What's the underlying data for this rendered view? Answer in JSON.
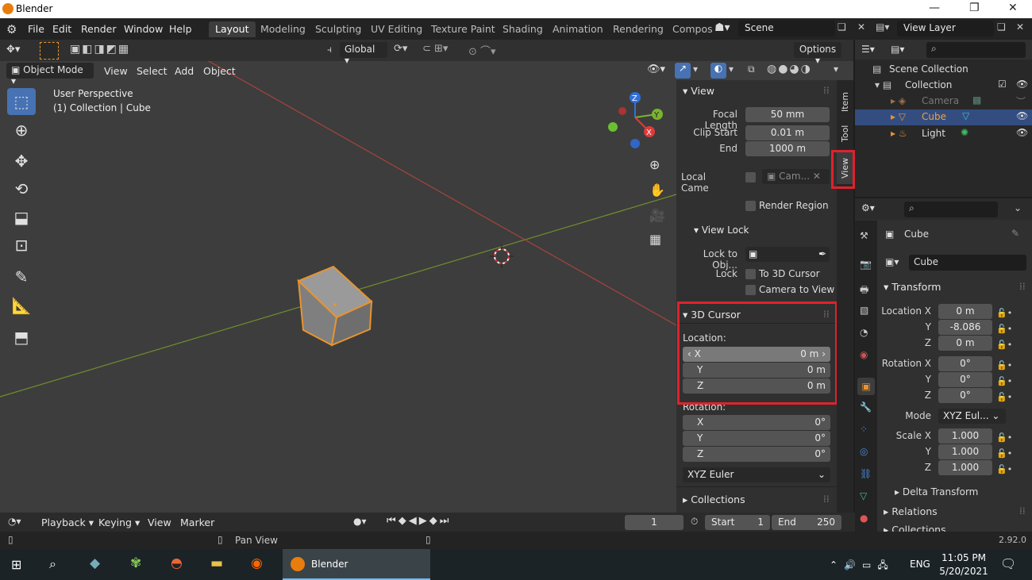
{
  "window": {
    "title": "Blender"
  },
  "menu": [
    "File",
    "Edit",
    "Render",
    "Window",
    "Help"
  ],
  "workspaces": [
    "Layout",
    "Modeling",
    "Sculpting",
    "UV Editing",
    "Texture Paint",
    "Shading",
    "Animation",
    "Rendering",
    "Compos"
  ],
  "scene": "Scene",
  "view_layer": "View Layer",
  "header": {
    "transform_orientation": "Global",
    "options": "Options"
  },
  "viewport_header": {
    "mode": "Object Mode",
    "view": "View",
    "select": "Select",
    "add": "Add",
    "object": "Object"
  },
  "viewport": {
    "perspective": "User Perspective",
    "collection_info": "(1) Collection | Cube"
  },
  "gizmo": {
    "x": "X",
    "y": "Y",
    "z": "Z"
  },
  "npanel": {
    "tabs": [
      "Item",
      "Tool",
      "View"
    ],
    "view_section": "View",
    "focal_length_label": "Focal Length",
    "focal_length": "50 mm",
    "clip_start_label": "Clip Start",
    "clip_start": "0.01 m",
    "end_label": "End",
    "end": "1000 m",
    "local_camera_label": "Local Came",
    "local_camera_value": "Cam...",
    "render_region": "Render Region",
    "view_lock": "View Lock",
    "lock_to_obj": "Lock to Obj...",
    "lock_label": "Lock",
    "to_3d_cursor": "To 3D Cursor",
    "camera_to_view": "Camera to View",
    "cursor_section": "3D Cursor",
    "location_label": "Location:",
    "loc_x_label": "X",
    "loc_x": "0 m",
    "loc_y_label": "Y",
    "loc_y": "0 m",
    "loc_z_label": "Z",
    "loc_z": "0 m",
    "rotation_label": "Rotation:",
    "rot_x_label": "X",
    "rot_x": "0°",
    "rot_y_label": "Y",
    "rot_y": "0°",
    "rot_z_label": "Z",
    "rot_z": "0°",
    "rotation_mode": "XYZ Euler",
    "collections": "Collections"
  },
  "outliner": {
    "scene_collection": "Scene Collection",
    "collection": "Collection",
    "items": [
      "Camera",
      "Cube",
      "Light"
    ]
  },
  "properties": {
    "object_name": "Cube",
    "data_name": "Cube",
    "transform": "Transform",
    "loc_x_label": "Location X",
    "loc_x": "0 m",
    "loc_y_label": "Y",
    "loc_y": "-8.086",
    "loc_z_label": "Z",
    "loc_z": "0 m",
    "rot_x_label": "Rotation X",
    "rot_x": "0°",
    "rot_y_label": "Y",
    "rot_y": "0°",
    "rot_z_label": "Z",
    "rot_z": "0°",
    "mode_label": "Mode",
    "mode": "XYZ Eul...",
    "scale_x_label": "Scale X",
    "scale_x": "1.000",
    "scale_y_label": "Y",
    "scale_y": "1.000",
    "scale_z_label": "Z",
    "scale_z": "1.000",
    "delta": "Delta Transform",
    "relations": "Relations",
    "collections": "Collections"
  },
  "timeline": {
    "playback": "Playback",
    "keying": "Keying",
    "view": "View",
    "marker": "Marker",
    "current_frame": "1",
    "start_label": "Start",
    "start": "1",
    "end_label": "End",
    "end": "250"
  },
  "status": {
    "hint": "Pan View",
    "version": "2.92.0"
  },
  "taskbar": {
    "app": "Blender",
    "lang": "ENG",
    "time": "11:05 PM",
    "date": "5/20/2021"
  },
  "colors": {
    "accent": "#4772b3",
    "highlight": "#e0222d",
    "selection": "#e87d0d"
  }
}
